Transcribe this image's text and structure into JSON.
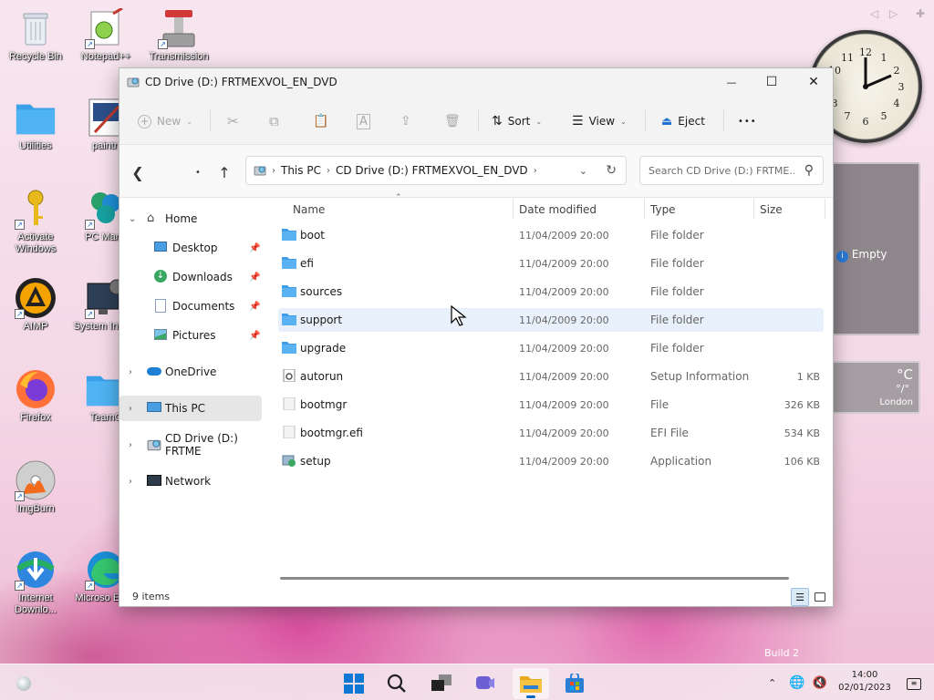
{
  "desktop": {
    "icons": [
      {
        "label": "Recycle Bin"
      },
      {
        "label": "Notepad++"
      },
      {
        "label": "Transmission"
      },
      {
        "label": "Utilities"
      },
      {
        "label": "paintn"
      },
      {
        "label": "Activate Windows"
      },
      {
        "label": "PC Mana"
      },
      {
        "label": "AIMP"
      },
      {
        "label": "System Inform"
      },
      {
        "label": "Firefox"
      },
      {
        "label": "TeamC"
      },
      {
        "label": "ImgBurn"
      },
      {
        "label": "Internet Downlo..."
      },
      {
        "label": "Microso Edge"
      }
    ],
    "gadget_panel_text": "Empty",
    "weather": {
      "unit": "°C",
      "value": "°/°",
      "city": "London"
    },
    "build_text": "Build 2"
  },
  "window": {
    "title": "CD Drive (D:) FRTMEXVOL_EN_DVD",
    "controls": {
      "minimize": "—",
      "maximize": "☐",
      "close": "✕"
    },
    "commandbar": {
      "new_label": "New",
      "sort_label": "Sort",
      "view_label": "View",
      "eject_label": "Eject",
      "more_label": "•••"
    },
    "address": {
      "crumbs": [
        "This PC",
        "CD Drive (D:) FRTMEXVOL_EN_DVD"
      ]
    },
    "search": {
      "placeholder": "Search CD Drive (D:) FRTME..."
    },
    "sidebar": {
      "items": [
        {
          "label": "Home"
        },
        {
          "label": "Desktop"
        },
        {
          "label": "Downloads"
        },
        {
          "label": "Documents"
        },
        {
          "label": "Pictures"
        },
        {
          "label": "OneDrive"
        },
        {
          "label": "This PC"
        },
        {
          "label": "CD Drive (D:) FRTME"
        },
        {
          "label": "Network"
        }
      ]
    },
    "columns": {
      "name": "Name",
      "date": "Date modified",
      "type": "Type",
      "size": "Size"
    },
    "files": [
      {
        "name": "boot",
        "date": "11/04/2009 20:00",
        "type": "File folder",
        "size": "",
        "icon": "folder-icon"
      },
      {
        "name": "efi",
        "date": "11/04/2009 20:00",
        "type": "File folder",
        "size": "",
        "icon": "folder-icon"
      },
      {
        "name": "sources",
        "date": "11/04/2009 20:00",
        "type": "File folder",
        "size": "",
        "icon": "folder-icon"
      },
      {
        "name": "support",
        "date": "11/04/2009 20:00",
        "type": "File folder",
        "size": "",
        "icon": "folder-icon"
      },
      {
        "name": "upgrade",
        "date": "11/04/2009 20:00",
        "type": "File folder",
        "size": "",
        "icon": "folder-icon"
      },
      {
        "name": "autorun",
        "date": "11/04/2009 20:00",
        "type": "Setup Information",
        "size": "1 KB",
        "icon": "settings-file-icon"
      },
      {
        "name": "bootmgr",
        "date": "11/04/2009 20:00",
        "type": "File",
        "size": "326 KB",
        "icon": "file-icon"
      },
      {
        "name": "bootmgr.efi",
        "date": "11/04/2009 20:00",
        "type": "EFI File",
        "size": "534 KB",
        "icon": "file-icon"
      },
      {
        "name": "setup",
        "date": "11/04/2009 20:00",
        "type": "Application",
        "size": "106 KB",
        "icon": "setup-app-icon"
      }
    ],
    "status": "9 items"
  },
  "taskbar": {
    "time": "14:00",
    "date": "02/01/2023"
  }
}
